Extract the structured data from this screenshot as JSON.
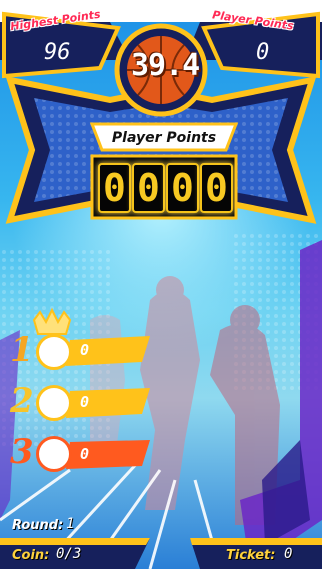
{
  "hud": {
    "highest_label": "Highest Points",
    "highest_value": "96",
    "player_label_top": "Player Points",
    "player_value_top": "0",
    "timer": "39.4"
  },
  "scoreboard": {
    "label": "Player Points",
    "digits": [
      "0",
      "0",
      "0",
      "0"
    ]
  },
  "leaderboard": [
    {
      "rank": "1",
      "score": "0",
      "color": "#f5a623"
    },
    {
      "rank": "2",
      "score": "0",
      "color": "#f7c42a"
    },
    {
      "rank": "3",
      "score": "0",
      "color": "#ff5a1f"
    }
  ],
  "footer": {
    "round_label": "Round:",
    "round_value": "1",
    "coin_label": "Coin:",
    "coin_value": "0/3",
    "ticket_label": "Ticket:",
    "ticket_value": "0"
  },
  "colors": {
    "accent_gold": "#ffc21a",
    "navy": "#16205c",
    "red_text": "#ff2a55"
  }
}
